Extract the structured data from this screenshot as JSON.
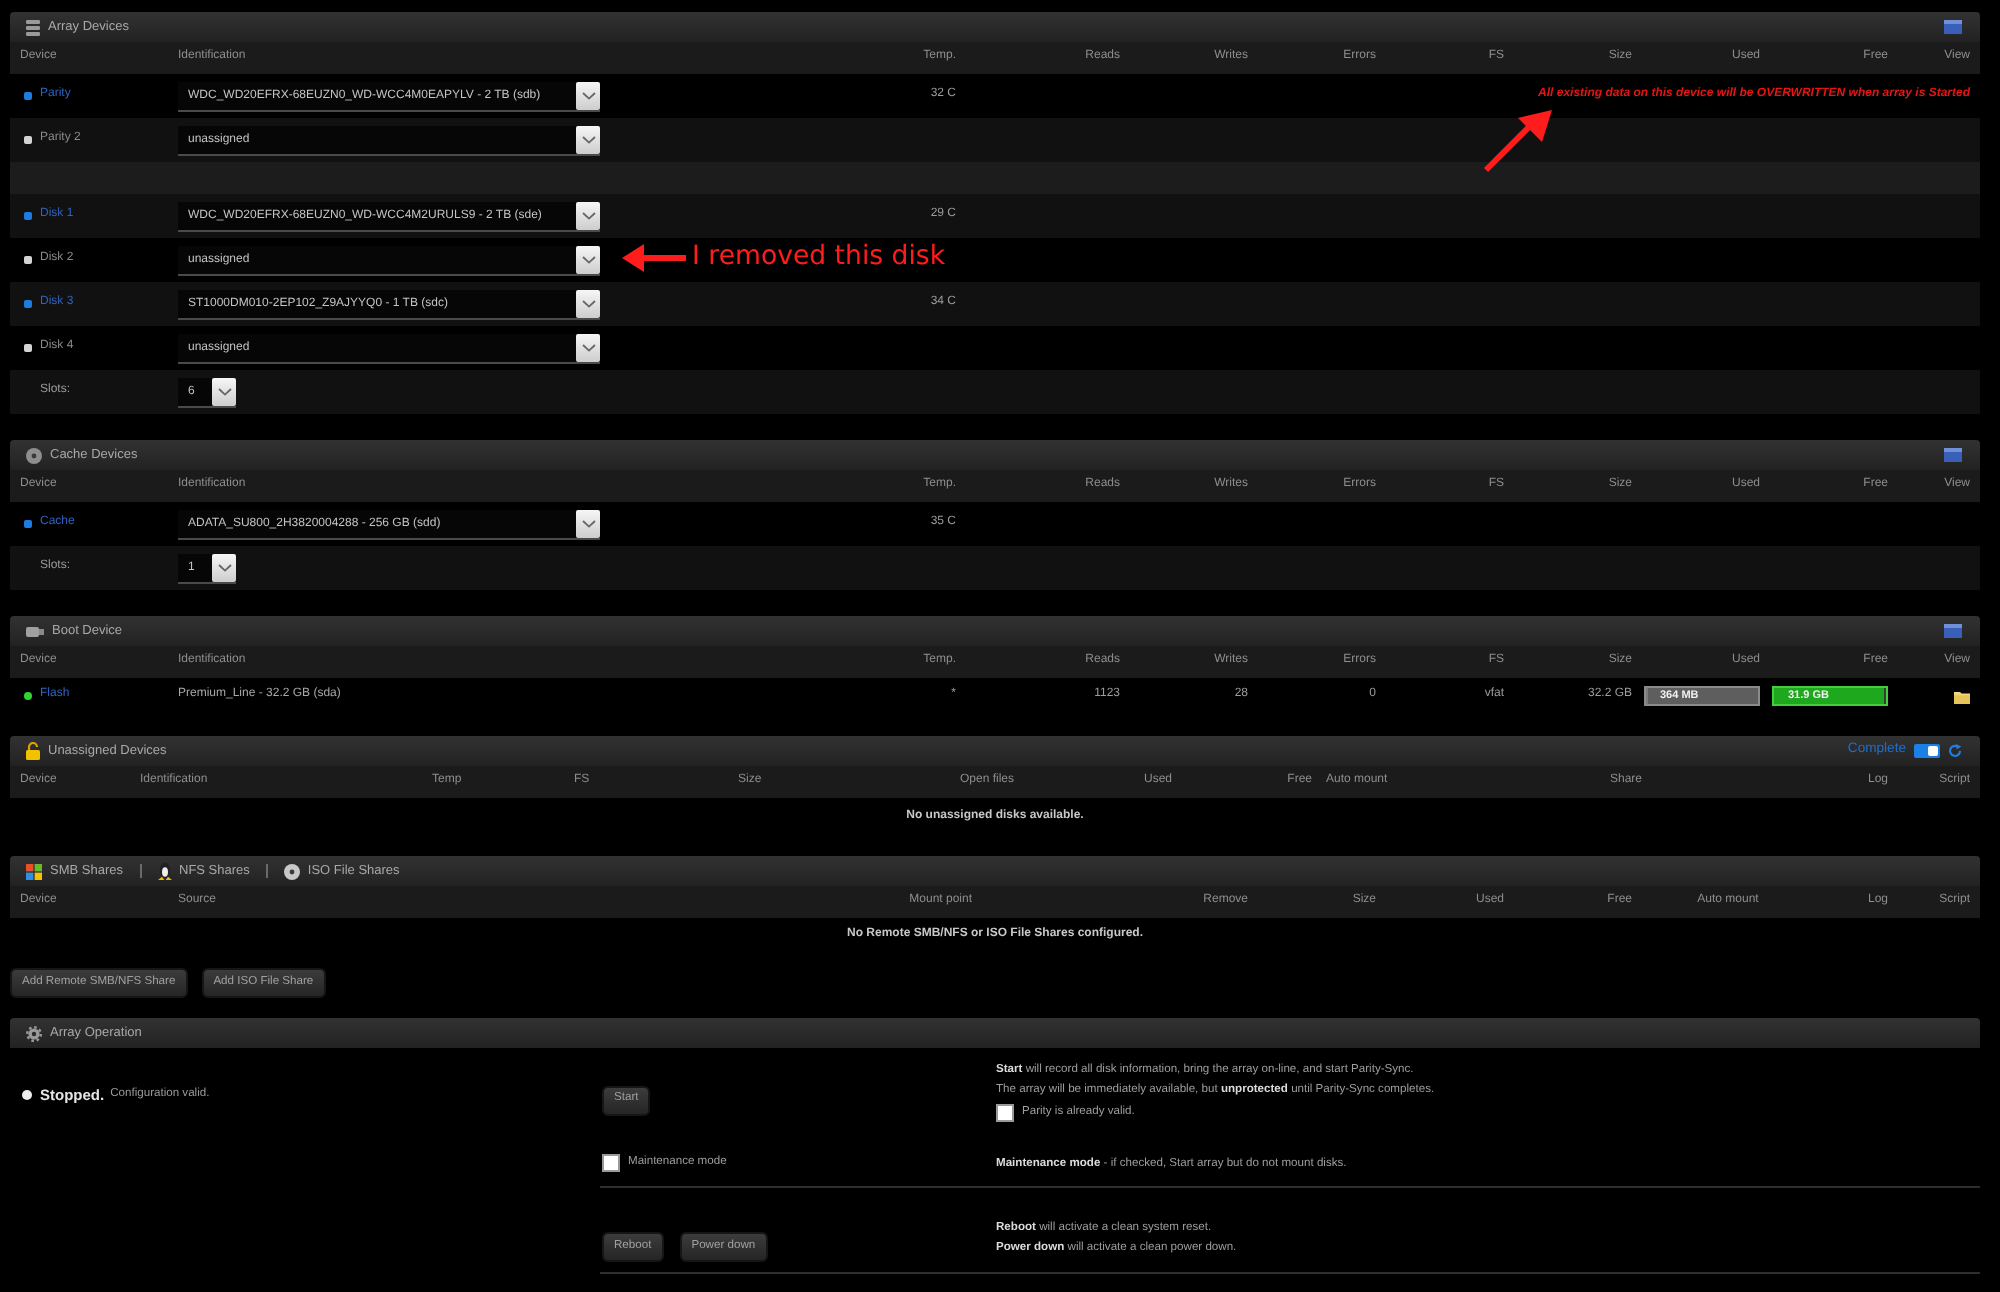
{
  "array_devices": {
    "title": "Array Devices",
    "columns": [
      "Device",
      "Identification",
      "Temp.",
      "Reads",
      "Writes",
      "Errors",
      "FS",
      "Size",
      "Used",
      "Free",
      "View"
    ],
    "rows": [
      {
        "kind": "device",
        "device": "Parity",
        "assigned": true,
        "color": "#1e7be0",
        "identification": "WDC_WD20EFRX-68EUZN0_WD-WCC4M0EAPYLV - 2 TB (sdb)",
        "temp": "32 C",
        "warning": "All existing data on this device will be OVERWRITTEN when array is Started"
      },
      {
        "kind": "device",
        "device": "Parity 2",
        "assigned": false,
        "color": "#d4d4d4",
        "identification": "unassigned"
      },
      {
        "kind": "spacer"
      },
      {
        "kind": "device",
        "device": "Disk 1",
        "assigned": true,
        "color": "#1e7be0",
        "identification": "WDC_WD20EFRX-68EUZN0_WD-WCC4M2URULS9 - 2 TB (sde)",
        "temp": "29 C"
      },
      {
        "kind": "device",
        "device": "Disk 2",
        "assigned": false,
        "color": "#d4d4d4",
        "identification": "unassigned"
      },
      {
        "kind": "device",
        "device": "Disk 3",
        "assigned": true,
        "color": "#1e7be0",
        "identification": "ST1000DM010-2EP102_Z9AJYYQ0 - 1 TB (sdc)",
        "temp": "34 C"
      },
      {
        "kind": "device",
        "device": "Disk 4",
        "assigned": false,
        "color": "#d4d4d4",
        "identification": "unassigned"
      },
      {
        "kind": "slots",
        "label": "Slots:",
        "value": "6"
      }
    ]
  },
  "cache_devices": {
    "title": "Cache Devices",
    "columns": [
      "Device",
      "Identification",
      "Temp.",
      "Reads",
      "Writes",
      "Errors",
      "FS",
      "Size",
      "Used",
      "Free",
      "View"
    ],
    "rows": [
      {
        "kind": "device",
        "device": "Cache",
        "assigned": true,
        "color": "#1e7be0",
        "identification": "ADATA_SU800_2H3820004288 - 256 GB (sdd)",
        "temp": "35 C"
      },
      {
        "kind": "slots",
        "label": "Slots:",
        "value": "1"
      }
    ]
  },
  "boot_device": {
    "title": "Boot Device",
    "columns": [
      "Device",
      "Identification",
      "Temp.",
      "Reads",
      "Writes",
      "Errors",
      "FS",
      "Size",
      "Used",
      "Free",
      "View"
    ],
    "rows": [
      {
        "kind": "boot",
        "device": "Flash",
        "assigned": true,
        "color": "#2fd62f",
        "identification": "Premium_Line - 32.2 GB (sda)",
        "temp": "*",
        "reads": "1123",
        "writes": "28",
        "errors": "0",
        "fs": "vfat",
        "size": "32.2 GB",
        "used": {
          "text": "364 MB",
          "level": 0.01
        },
        "free": {
          "text": "31.9 GB",
          "level": 0.99
        }
      }
    ]
  },
  "unassigned_devices": {
    "title": "Unassigned Devices",
    "switch": {
      "label": "Complete",
      "on": true
    },
    "columns": [
      "Device",
      "Identification",
      "Temp",
      "FS",
      "Size",
      "Open files",
      "Used",
      "Free",
      "Auto mount",
      "Share",
      "Log",
      "Script"
    ],
    "message": "No unassigned disks available."
  },
  "shares": {
    "titles": [
      "SMB Shares",
      "NFS Shares",
      "ISO File Shares"
    ],
    "columns": [
      "Device",
      "Source",
      "Mount point",
      "Remove",
      "Size",
      "Used",
      "Free",
      "Auto mount",
      "Log",
      "Script"
    ],
    "message": "No Remote SMB/NFS or ISO File Shares configured.",
    "buttons": [
      "Add Remote SMB/NFS Share",
      "Add ISO File Share"
    ]
  },
  "array_operation": {
    "title": "Array Operation",
    "status": {
      "state": "Stopped.",
      "detail": "Configuration valid."
    },
    "rows": [
      {
        "kind": "start",
        "controls": [
          {
            "kind": "button",
            "label": "Start"
          }
        ],
        "lines": [
          "**Start** will record all disk information, bring the array on-line, and start Parity-Sync.",
          "The array will be immediately available, but **unprotected** until Parity-Sync completes."
        ],
        "option": {
          "label": "Parity is already valid.",
          "checked": false
        },
        "divider": false
      },
      {
        "kind": "maintenance",
        "controls": [
          {
            "kind": "checkbox",
            "label": "Maintenance mode",
            "checked": false
          }
        ],
        "lines": [
          "**Maintenance mode** - if checked, Start array but do not mount disks."
        ],
        "divider": true
      },
      {
        "kind": "power",
        "controls": [
          {
            "kind": "button",
            "label": "Reboot"
          },
          {
            "kind": "button",
            "label": "Power down"
          }
        ],
        "lines": [
          "**Reboot** will activate a clean system reset.",
          "**Power down** will activate a clean power down."
        ],
        "divider": true
      }
    ]
  },
  "annotations": [
    {
      "kind": "callout",
      "text": "I removed this disk"
    },
    {
      "kind": "arrow"
    }
  ]
}
